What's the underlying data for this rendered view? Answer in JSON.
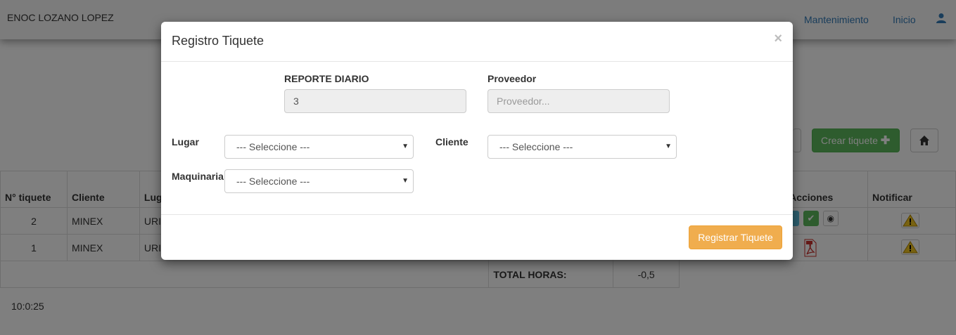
{
  "navbar": {
    "brand": "ENOC LOZANO LOPEZ",
    "links": [
      "Mantenimiento",
      "Inicio"
    ],
    "user_icon": "user-icon"
  },
  "toolbar": {
    "create_label": "Crear tiquete"
  },
  "table": {
    "headers": [
      "N° tiquete",
      "Cliente",
      "Lug",
      "Acciones",
      "Notificar"
    ],
    "rows": [
      {
        "num": "2",
        "cliente": "MINEX",
        "lugar": "URI"
      },
      {
        "num": "1",
        "cliente": "MINEX",
        "lugar": "URI"
      }
    ],
    "total_label": "TOTAL HORAS:",
    "total_value": "-0,5"
  },
  "clock": "10:0:25",
  "modal": {
    "title": "Registro Tiquete",
    "close": "×",
    "reporte_label": "REPORTE DIARIO",
    "reporte_value": "3",
    "proveedor_label": "Proveedor",
    "proveedor_placeholder": "Proveedor...",
    "lugar_label": "Lugar",
    "lugar_value": "--- Seleccione ---",
    "cliente_label": "Cliente",
    "cliente_value": "--- Seleccione ---",
    "maquinaria_label": "Maquinaria",
    "maquinaria_value": "--- Seleccione ---",
    "submit_label": "Registrar Tiquete"
  },
  "colors": {
    "primary_link": "#337ab7",
    "success": "#5cb85c",
    "warning": "#f0ad4e",
    "info": "#5bc0de"
  }
}
